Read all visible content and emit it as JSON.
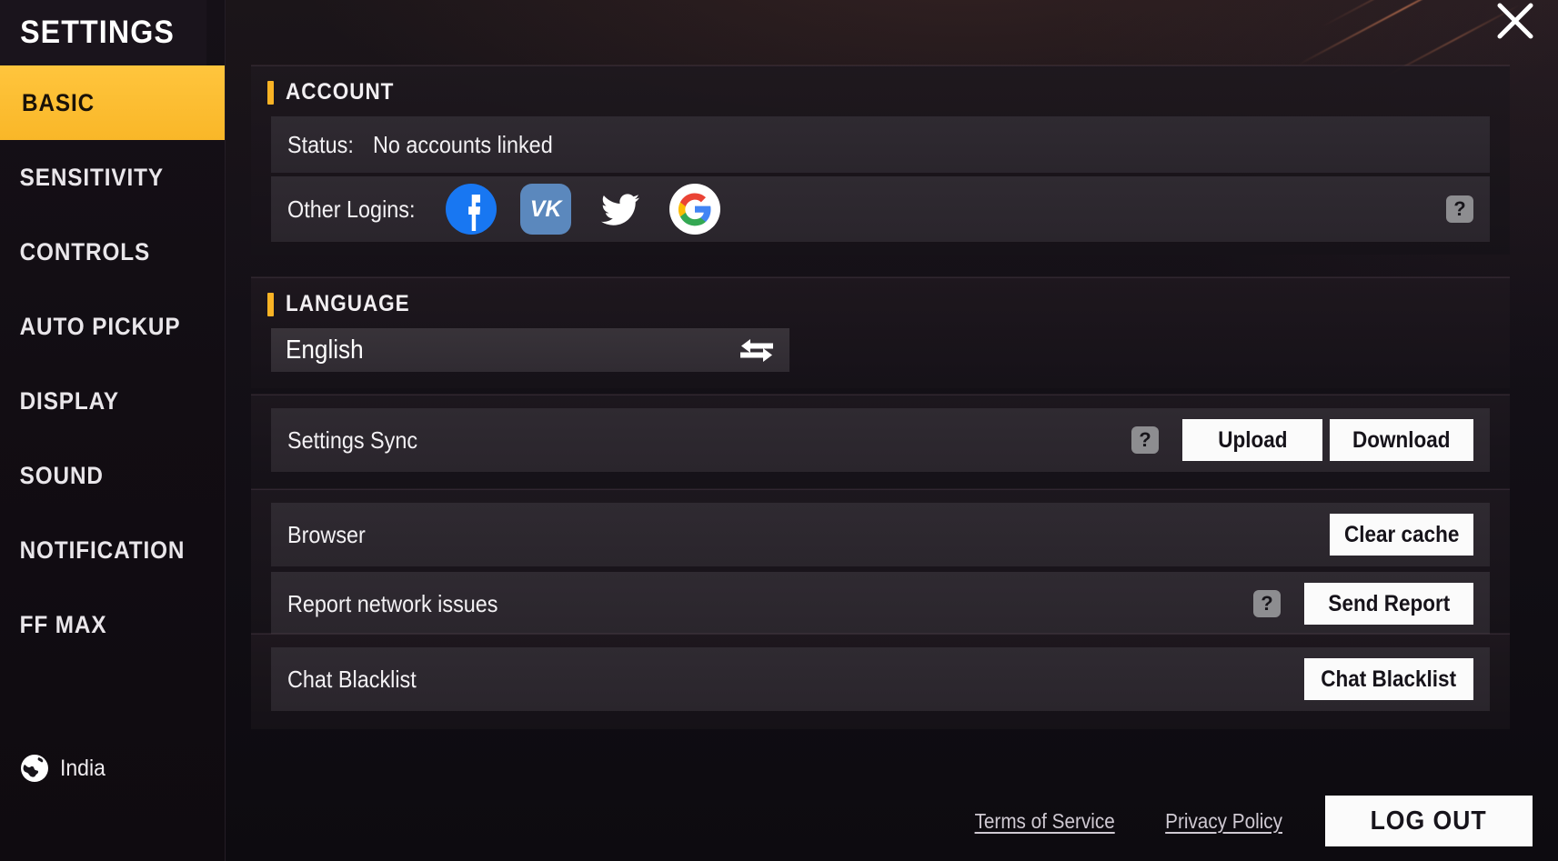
{
  "window": {
    "title": "SETTINGS",
    "close_icon": "close-icon",
    "accent_color": "#f9b325"
  },
  "sidebar": {
    "items": [
      {
        "label": "BASIC",
        "active": true
      },
      {
        "label": "SENSITIVITY",
        "active": false
      },
      {
        "label": "CONTROLS",
        "active": false
      },
      {
        "label": "AUTO PICKUP",
        "active": false
      },
      {
        "label": "DISPLAY",
        "active": false
      },
      {
        "label": "SOUND",
        "active": false
      },
      {
        "label": "NOTIFICATION",
        "active": false
      },
      {
        "label": "FF MAX",
        "active": false
      }
    ],
    "region": {
      "label": "India",
      "icon": "globe-icon"
    }
  },
  "account": {
    "heading": "ACCOUNT",
    "status_label": "Status:",
    "status_value": "No accounts linked",
    "other_logins_label": "Other Logins:",
    "providers": [
      {
        "name": "facebook",
        "glyph": "f"
      },
      {
        "name": "vk",
        "glyph": "VK"
      },
      {
        "name": "twitter",
        "glyph": "twitter-bird"
      },
      {
        "name": "google",
        "glyph": "G"
      }
    ],
    "help": "?"
  },
  "language": {
    "heading": "LANGUAGE",
    "selected": "English",
    "swap_icon": "swap-arrows-icon"
  },
  "settings_sync": {
    "label": "Settings Sync",
    "help": "?",
    "upload_label": "Upload",
    "download_label": "Download"
  },
  "browser": {
    "label": "Browser",
    "clear_cache_label": "Clear cache"
  },
  "network_report": {
    "label": "Report network issues",
    "help": "?",
    "send_label": "Send Report"
  },
  "chat_blacklist": {
    "label": "Chat Blacklist",
    "button_label": "Chat Blacklist"
  },
  "footer": {
    "terms_label": "Terms of Service",
    "privacy_label": "Privacy Policy",
    "logout_label": "LOG OUT"
  }
}
